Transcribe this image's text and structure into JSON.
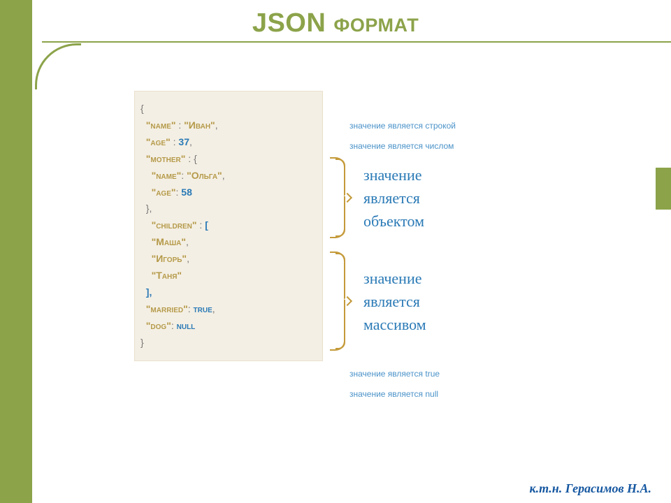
{
  "title": "JSON формат",
  "footer": "к.т.н. Герасимов Н.А.",
  "code": {
    "open": "{",
    "name_key": "\"name\"",
    "name_val": "\"Иван\"",
    "age_key": "\"age\"",
    "age_val": "37",
    "mother_key": "\"mother\"",
    "mother_open": "{",
    "mother_name_key": "\"name\"",
    "mother_name_val": "\"Ольга\"",
    "mother_age_key": "\"age\"",
    "mother_age_val": "58",
    "mother_close": "},",
    "children_key": "\"children\"",
    "children_open": "[",
    "children_0": "\"Маша\"",
    "children_1": "\"Игорь\"",
    "children_2": "\"Таня\"",
    "children_close": "],",
    "married_key": "\"married\"",
    "married_val": "true",
    "dog_key": "\"dog\"",
    "dog_val": "null",
    "close": "}"
  },
  "notes": {
    "string_small": "значение является строкой",
    "number_small": "значение является числом",
    "object_big_l1": "значение",
    "object_big_l2": "является",
    "object_big_l3": "объектом",
    "array_big_l1": "значение",
    "array_big_l2": "является",
    "array_big_l3": "массивом",
    "true_small": "значение является true",
    "null_small": "значение является null"
  }
}
